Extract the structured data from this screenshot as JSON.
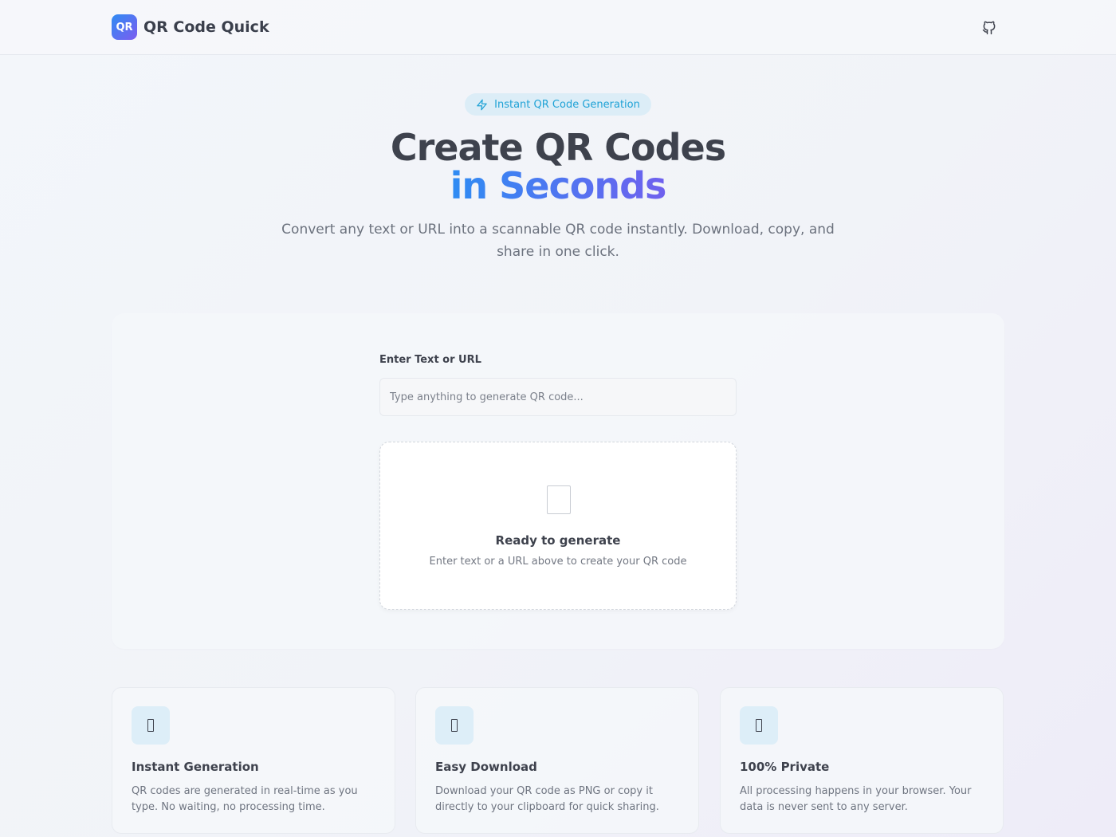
{
  "header": {
    "logo_text": "QR",
    "brand_name": "QR Code Quick",
    "github_icon": "github-icon"
  },
  "hero": {
    "badge_icon": "lightning-icon",
    "badge_text": "Instant QR Code Generation",
    "title_line1": "Create QR Codes",
    "title_line2": "in Seconds",
    "subtitle": "Convert any text or URL into a scannable QR code instantly. Download, copy, and share in one click."
  },
  "generator": {
    "input_label": "Enter Text or URL",
    "input_value": "",
    "input_placeholder": "Type anything to generate QR code...",
    "preview_icon": "qr-placeholder-icon",
    "preview_title": "Ready to generate",
    "preview_subtitle": "Enter text or a URL above to create your QR code"
  },
  "features": [
    {
      "icon": "zap-icon",
      "title": "Instant Generation",
      "description": "QR codes are generated in real-time as you type. No waiting, no processing time."
    },
    {
      "icon": "download-icon",
      "title": "Easy Download",
      "description": "Download your QR code as PNG or copy it directly to your clipboard for quick sharing."
    },
    {
      "icon": "shield-icon",
      "title": "100% Private",
      "description": "All processing happens in your browser. Your data is never sent to any server."
    }
  ],
  "colors": {
    "accent_blue": "#2f8cf3",
    "accent_purple": "#6f60ee",
    "badge_text": "#1fa2d6",
    "badge_bg": "#dcedf7"
  }
}
